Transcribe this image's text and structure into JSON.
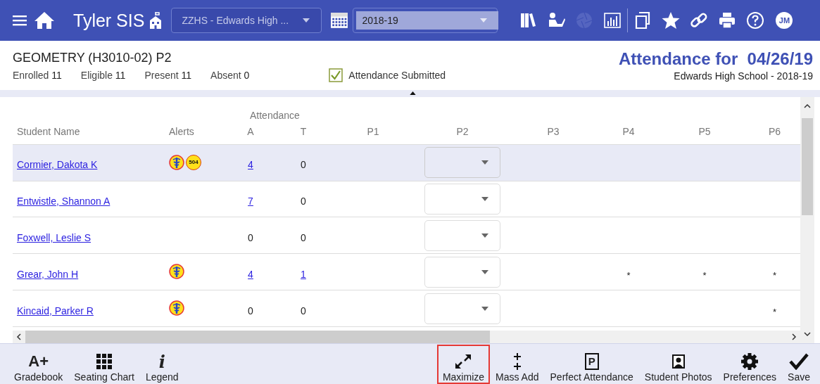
{
  "header": {
    "app_title": "Tyler SIS",
    "school_select": {
      "value": "ZZHS - Edwards High ..."
    },
    "year_select": {
      "value": "2018-19"
    },
    "tools": [
      {
        "kind": "books",
        "disabled": false
      },
      {
        "kind": "reader",
        "disabled": false
      },
      {
        "kind": "aperture",
        "disabled": true
      },
      {
        "kind": "chart",
        "disabled": false
      },
      {
        "kind": "copy",
        "disabled": false
      },
      {
        "kind": "star",
        "disabled": false
      },
      {
        "kind": "link",
        "disabled": false
      },
      {
        "kind": "print",
        "disabled": false
      },
      {
        "kind": "help",
        "disabled": false
      }
    ],
    "avatar": {
      "initials": "JM"
    }
  },
  "section": {
    "title": "GEOMETRY (H3010-02) P2",
    "stats": [
      {
        "label": "Enrolled",
        "value": "11"
      },
      {
        "label": "Eligible",
        "value": "11"
      },
      {
        "label": "Present",
        "value": "11"
      },
      {
        "label": "Absent",
        "value": "0"
      }
    ],
    "submitted": {
      "label": "Attendance Submitted",
      "checked": true
    },
    "heading": "Attendance for  04/26/19",
    "school_year": "Edwards High School - 2018-19"
  },
  "table": {
    "group_header": "Attendance",
    "columns": [
      {
        "label": "Student Name",
        "kind": "name"
      },
      {
        "label": "Alerts",
        "kind": "alerts"
      },
      {
        "label": "A",
        "kind": "count"
      },
      {
        "label": "T",
        "kind": "count"
      },
      {
        "label": "P1",
        "kind": "period"
      },
      {
        "label": "P2",
        "kind": "period"
      },
      {
        "label": "P3",
        "kind": "period"
      },
      {
        "label": "P4",
        "kind": "period"
      },
      {
        "label": "P5",
        "kind": "period"
      },
      {
        "label": "P6",
        "kind": "period"
      }
    ],
    "rows": [
      {
        "name": "Cormier, Dakota K",
        "selected": true,
        "alerts": [
          {
            "kind": "medical"
          },
          {
            "kind": "badge",
            "text": "504"
          }
        ],
        "counts": [
          {
            "value": "4",
            "link": true
          },
          {
            "value": "0",
            "link": false
          }
        ],
        "periods": [
          {
            "kind": "blank"
          },
          {
            "kind": "select"
          },
          {
            "kind": "blank"
          },
          {
            "kind": "blank"
          },
          {
            "kind": "blank"
          },
          {
            "kind": "blank"
          }
        ]
      },
      {
        "name": "Entwistle, Shannon A",
        "selected": false,
        "alerts": [],
        "counts": [
          {
            "value": "7",
            "link": true
          },
          {
            "value": "0",
            "link": false
          }
        ],
        "periods": [
          {
            "kind": "blank"
          },
          {
            "kind": "select"
          },
          {
            "kind": "blank"
          },
          {
            "kind": "blank"
          },
          {
            "kind": "blank"
          },
          {
            "kind": "blank"
          }
        ]
      },
      {
        "name": "Foxwell, Leslie S",
        "selected": false,
        "alerts": [],
        "counts": [
          {
            "value": "0",
            "link": false
          },
          {
            "value": "0",
            "link": false
          }
        ],
        "periods": [
          {
            "kind": "blank"
          },
          {
            "kind": "select"
          },
          {
            "kind": "blank"
          },
          {
            "kind": "blank"
          },
          {
            "kind": "blank"
          },
          {
            "kind": "blank"
          }
        ]
      },
      {
        "name": "Grear, John H",
        "selected": false,
        "alerts": [
          {
            "kind": "medical"
          }
        ],
        "counts": [
          {
            "value": "4",
            "link": true
          },
          {
            "value": "1",
            "link": true
          }
        ],
        "periods": [
          {
            "kind": "blank"
          },
          {
            "kind": "select"
          },
          {
            "kind": "blank"
          },
          {
            "kind": "mark",
            "text": "*"
          },
          {
            "kind": "mark",
            "text": "*"
          },
          {
            "kind": "mark",
            "text": "*"
          }
        ]
      },
      {
        "name": "Kincaid, Parker R",
        "selected": false,
        "alerts": [
          {
            "kind": "medical"
          }
        ],
        "counts": [
          {
            "value": "0",
            "link": false
          },
          {
            "value": "0",
            "link": false
          }
        ],
        "periods": [
          {
            "kind": "blank"
          },
          {
            "kind": "select"
          },
          {
            "kind": "blank"
          },
          {
            "kind": "blank"
          },
          {
            "kind": "blank"
          },
          {
            "kind": "mark",
            "text": "*"
          }
        ]
      }
    ]
  },
  "toolbar": {
    "left": [
      {
        "label": "Gradebook",
        "kind": "text",
        "icon_text": "A+",
        "highlighted": false
      },
      {
        "label": "Seating Chart",
        "kind": "grid",
        "highlighted": false
      },
      {
        "label": "Legend",
        "kind": "text-italic",
        "icon_text": "i",
        "highlighted": false
      }
    ],
    "right": [
      {
        "label": "Maximize",
        "kind": "maximize",
        "highlighted": true
      },
      {
        "label": "Mass Add",
        "kind": "plus",
        "highlighted": false
      },
      {
        "label": "Perfect Attendance",
        "kind": "boxed",
        "icon_text": "P",
        "highlighted": false
      },
      {
        "label": "Student Photos",
        "kind": "photo",
        "highlighted": false
      },
      {
        "label": "Preferences",
        "kind": "gear",
        "highlighted": false
      },
      {
        "label": "Save",
        "kind": "check",
        "highlighted": false
      }
    ]
  }
}
